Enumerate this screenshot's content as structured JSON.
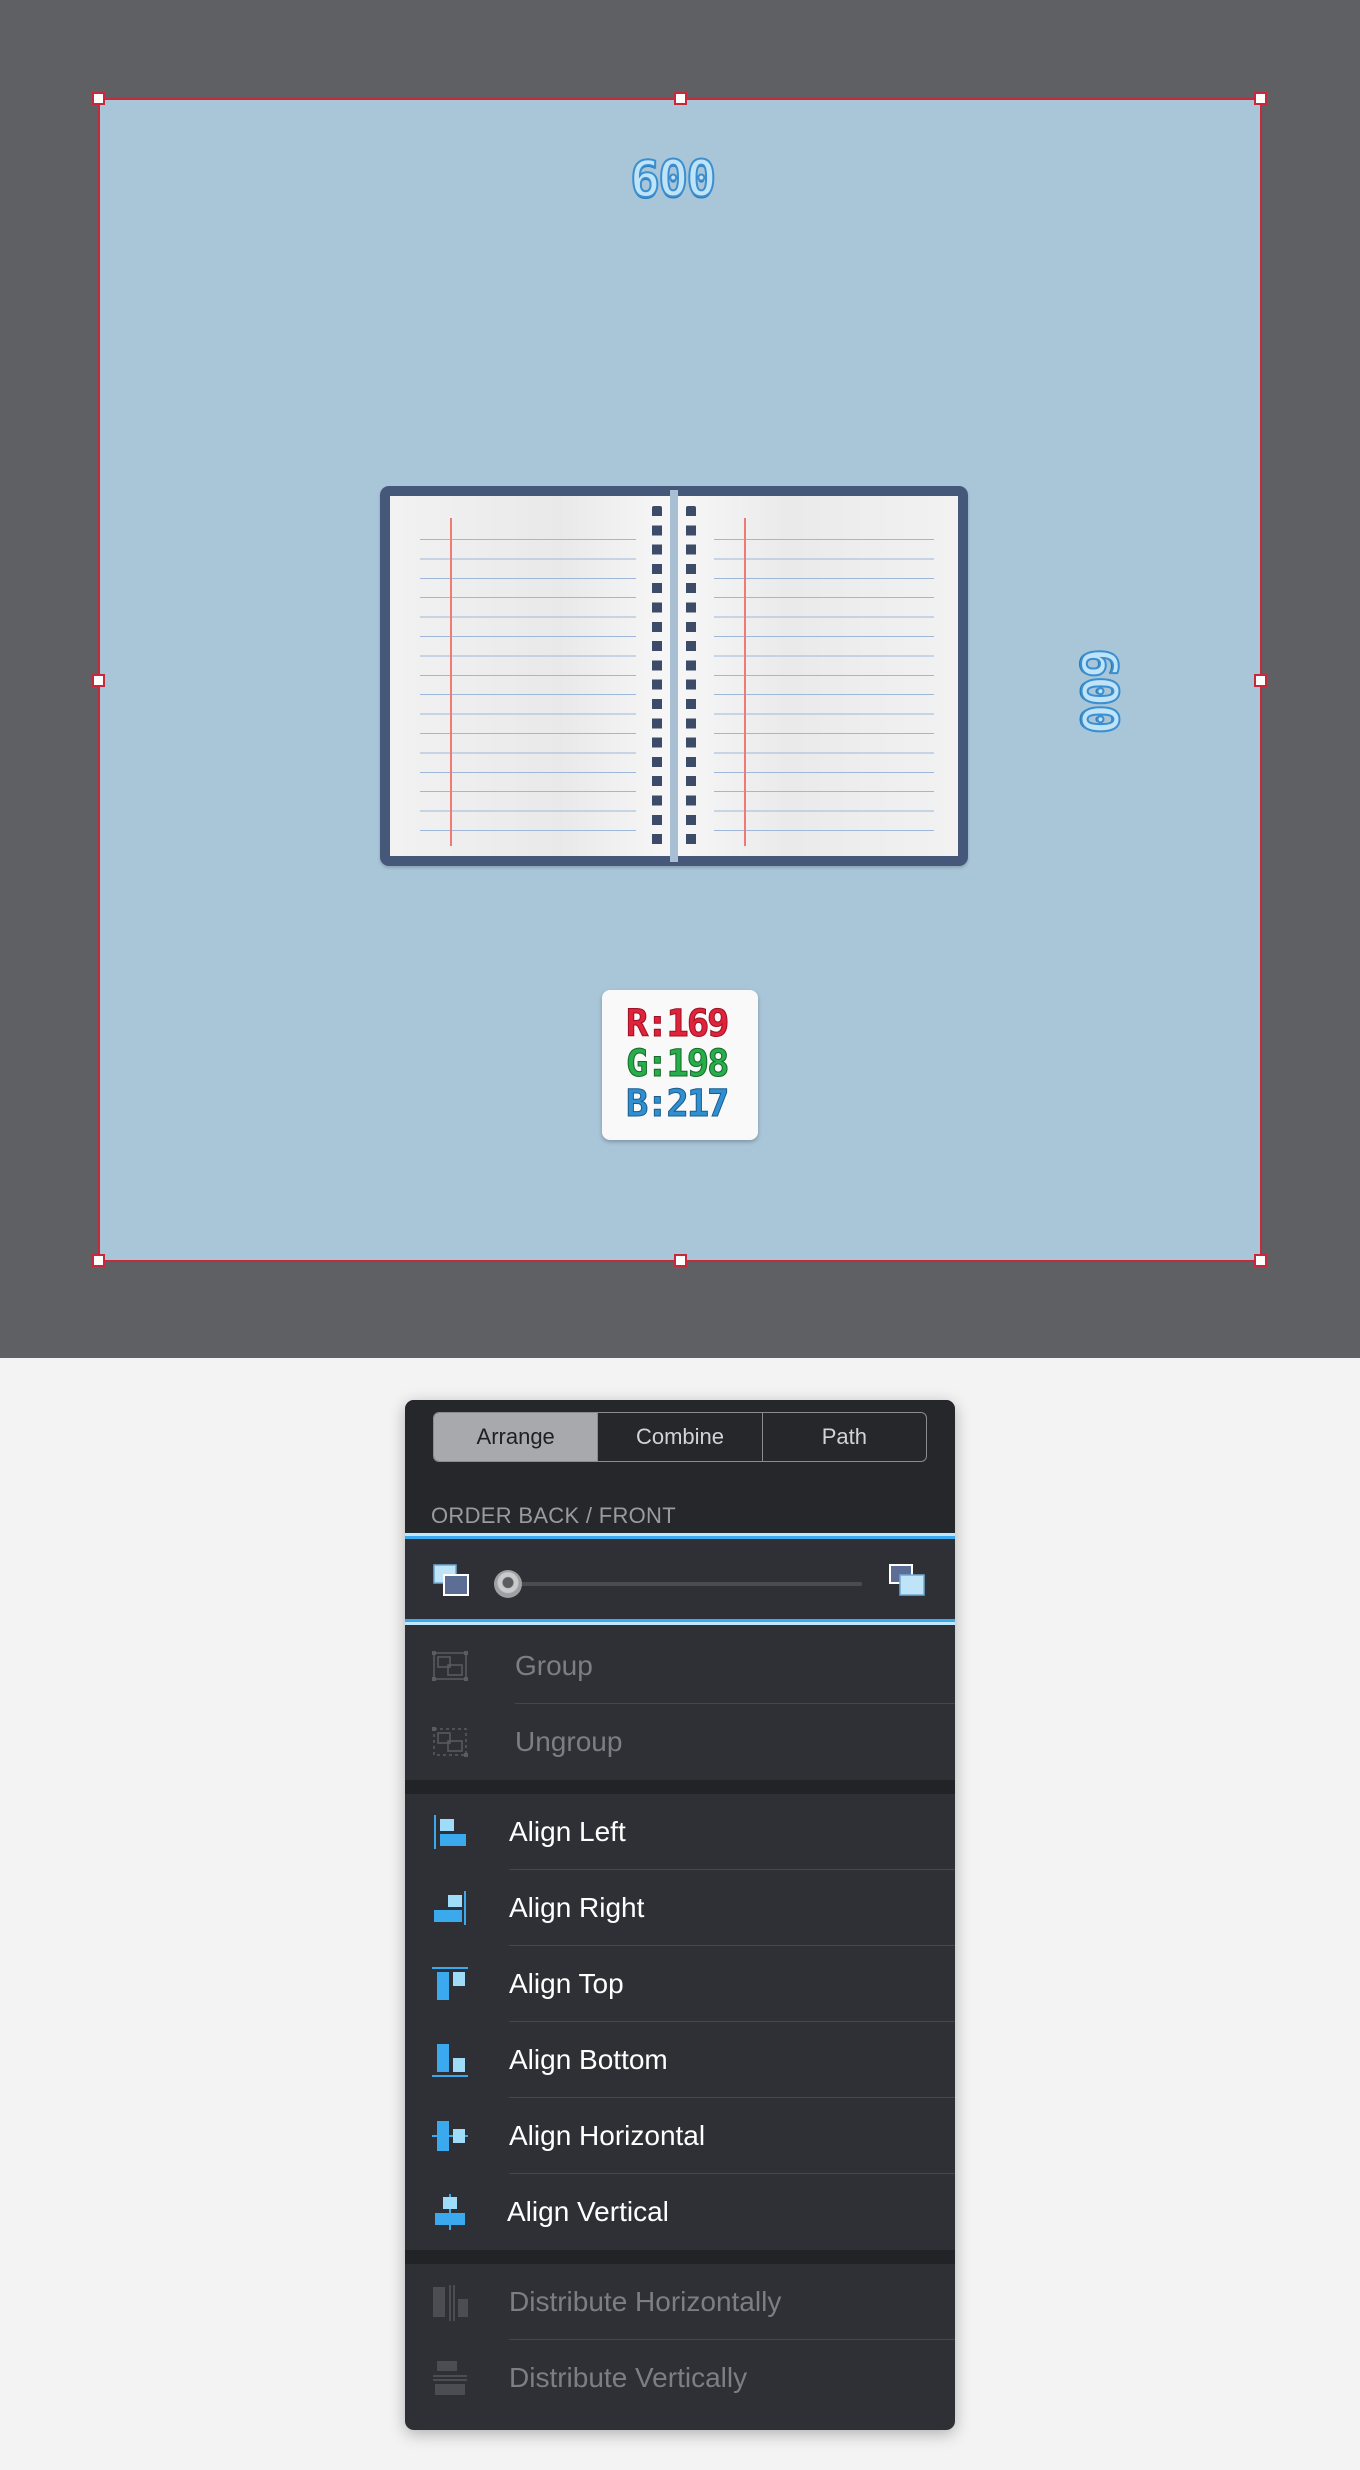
{
  "canvas": {
    "artboard_color": "#a9c6d9",
    "width_label": "600",
    "height_label": "600",
    "rgb": {
      "r": "R:169",
      "g": "G:198",
      "b": "B:217"
    }
  },
  "panel": {
    "tabs": [
      {
        "label": "Arrange",
        "active": true
      },
      {
        "label": "Combine",
        "active": false
      },
      {
        "label": "Path",
        "active": false
      }
    ],
    "order_section_title": "ORDER BACK / FRONT",
    "order_slider_value": 0,
    "group_items": [
      {
        "label": "Group",
        "icon": "group-icon",
        "enabled": false
      },
      {
        "label": "Ungroup",
        "icon": "ungroup-icon",
        "enabled": false
      }
    ],
    "align_items": [
      {
        "label": "Align Left",
        "icon": "align-left-icon",
        "enabled": true
      },
      {
        "label": "Align Right",
        "icon": "align-right-icon",
        "enabled": true
      },
      {
        "label": "Align Top",
        "icon": "align-top-icon",
        "enabled": true
      },
      {
        "label": "Align Bottom",
        "icon": "align-bottom-icon",
        "enabled": true
      },
      {
        "label": "Align Horizontal",
        "icon": "align-horizontal-icon",
        "enabled": true
      },
      {
        "label": "Align Vertical",
        "icon": "align-vertical-icon",
        "enabled": true
      }
    ],
    "distribute_items": [
      {
        "label": "Distribute Horizontally",
        "icon": "distribute-horizontally-icon",
        "enabled": false
      },
      {
        "label": "Distribute Vertically",
        "icon": "distribute-vertically-icon",
        "enabled": false
      }
    ],
    "accent_color": "#3aa9ee"
  }
}
